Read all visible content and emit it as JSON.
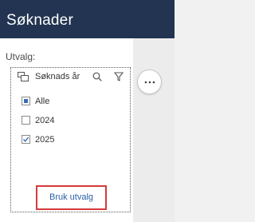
{
  "header": {
    "title": "Søknader"
  },
  "filter": {
    "section_label": "Utvalg:",
    "title": "Søknads år",
    "options": [
      {
        "label": "Alle",
        "state": "partial"
      },
      {
        "label": "2024",
        "state": "unchecked"
      },
      {
        "label": "2025",
        "state": "checked"
      }
    ],
    "apply_label": "Bruk utvalg"
  },
  "colors": {
    "header_bg": "#223451",
    "accent": "#2a5ea8",
    "highlight": "#d43a3a"
  },
  "icons": [
    "list-icon",
    "search-icon",
    "filter-icon",
    "check-icon",
    "more-icon"
  ]
}
